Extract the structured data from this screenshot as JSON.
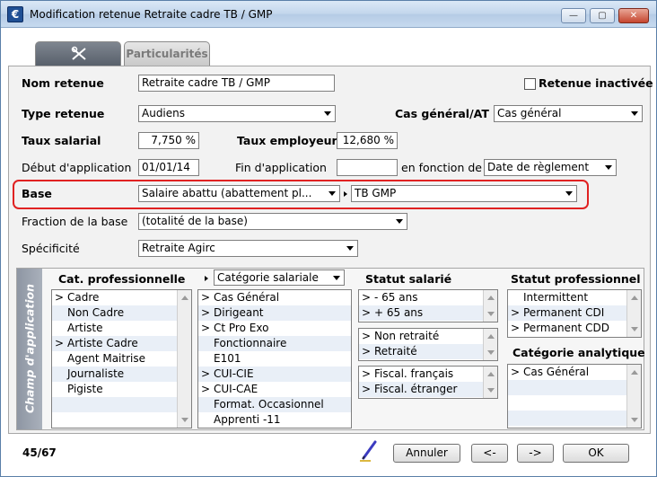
{
  "window": {
    "title": "Modification retenue Retraite cadre TB / GMP",
    "app_icon": "€"
  },
  "title_buttons": {
    "minimize": "—",
    "maximize": "▢",
    "close": "✕"
  },
  "tabs": {
    "second_label": "Particularités"
  },
  "form": {
    "nom_label": "Nom retenue",
    "nom_value": "Retraite cadre TB / GMP",
    "inactive_label": "Retenue inactivée",
    "type_label": "Type retenue",
    "type_value": "Audiens",
    "cas_label": "Cas général/AT",
    "cas_value": "Cas général",
    "taux_sal_label": "Taux salarial",
    "taux_sal_value": "7,750 %",
    "taux_emp_label": "Taux employeur",
    "taux_emp_value": "12,680 %",
    "debut_label": "Début d'application",
    "debut_value": "01/01/14",
    "fin_label": "Fin d'application",
    "fin_value": "",
    "fonction_label": "en fonction de",
    "fonction_value": "Date de règlement",
    "base_label": "Base",
    "base_value": "Salaire abattu (abattement pl...",
    "base2_value": "TB GMP",
    "fraction_label": "Fraction de la base",
    "fraction_value": "(totalité de la base)",
    "specificite_label": "Spécificité",
    "specificite_value": "Retraite Agirc"
  },
  "champ": {
    "vertical_label": "Champ d'application",
    "cat_pro_header": "Cat. professionnelle",
    "cat_pro_items": [
      {
        "mark": ">",
        "label": "Cadre"
      },
      {
        "mark": "",
        "label": "Non Cadre"
      },
      {
        "mark": "",
        "label": "Artiste"
      },
      {
        "mark": ">",
        "label": "Artiste Cadre"
      },
      {
        "mark": "",
        "label": "Agent Maitrise"
      },
      {
        "mark": "",
        "label": "Journaliste"
      },
      {
        "mark": "",
        "label": "Pigiste"
      },
      {
        "mark": "",
        "label": ""
      },
      {
        "mark": "",
        "label": ""
      }
    ],
    "cat_sal_combo": "Catégorie salariale",
    "cat_sal_items": [
      {
        "mark": ">",
        "label": "Cas Général"
      },
      {
        "mark": ">",
        "label": "Dirigeant"
      },
      {
        "mark": ">",
        "label": "Ct Pro Exo"
      },
      {
        "mark": "",
        "label": "Fonctionnaire"
      },
      {
        "mark": "",
        "label": "E101"
      },
      {
        "mark": ">",
        "label": "CUI-CIE"
      },
      {
        "mark": ">",
        "label": "CUI-CAE"
      },
      {
        "mark": "",
        "label": "Format. Occasionnel"
      },
      {
        "mark": "",
        "label": "Apprenti -11"
      }
    ],
    "statut_sal_header": "Statut salarié",
    "statut_sal_items": [
      {
        "mark": ">",
        "label": "- 65 ans"
      },
      {
        "mark": ">",
        "label": "+ 65 ans"
      }
    ],
    "retraite_items": [
      {
        "mark": ">",
        "label": "Non retraité"
      },
      {
        "mark": ">",
        "label": "Retraité"
      }
    ],
    "fiscal_items": [
      {
        "mark": ">",
        "label": "Fiscal. français"
      },
      {
        "mark": ">",
        "label": "Fiscal. étranger"
      }
    ],
    "statut_pro_header": "Statut professionnel",
    "statut_pro_items": [
      {
        "mark": "",
        "label": "Intermittent"
      },
      {
        "mark": ">",
        "label": "Permanent CDI"
      },
      {
        "mark": ">",
        "label": "Permanent CDD"
      }
    ],
    "cat_analytique_header": "Catégorie analytique",
    "cat_analytique_items": [
      {
        "mark": ">",
        "label": "Cas Général"
      },
      {
        "mark": "",
        "label": ""
      },
      {
        "mark": "",
        "label": ""
      },
      {
        "mark": "",
        "label": ""
      }
    ]
  },
  "footer": {
    "counter": "45/67",
    "annuler": "Annuler",
    "prev": "<-",
    "next": "->",
    "ok": "OK"
  },
  "colors": {
    "highlight": "#e02222",
    "panel": "#f2f2f2",
    "band": "#9aa1ad"
  }
}
